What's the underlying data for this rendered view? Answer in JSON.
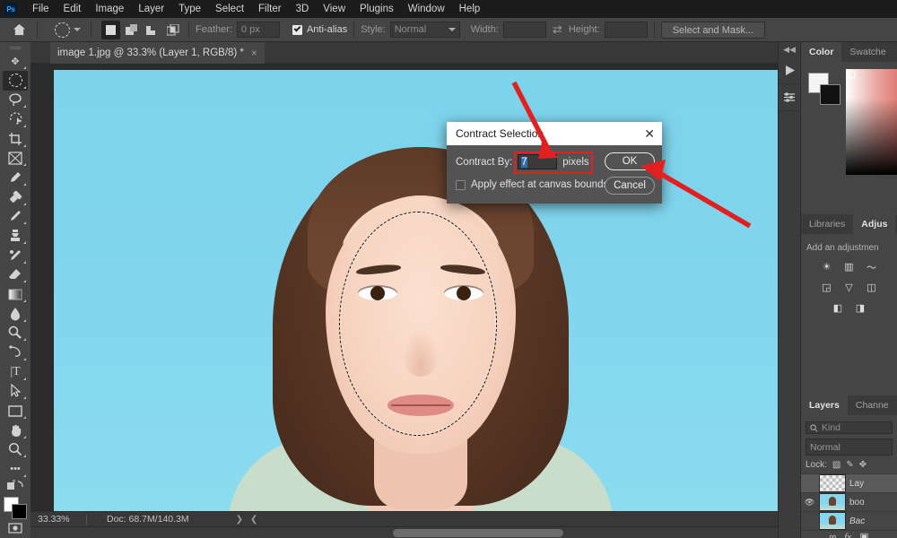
{
  "app": {
    "name": "Ps",
    "logo_bg": "#001e36",
    "logo_fg": "#31a8ff"
  },
  "menubar": {
    "items": [
      {
        "label": "File"
      },
      {
        "label": "Edit"
      },
      {
        "label": "Image"
      },
      {
        "label": "Layer"
      },
      {
        "label": "Type"
      },
      {
        "label": "Select"
      },
      {
        "label": "Filter"
      },
      {
        "label": "3D"
      },
      {
        "label": "View"
      },
      {
        "label": "Plugins"
      },
      {
        "label": "Window"
      },
      {
        "label": "Help"
      }
    ]
  },
  "options_bar": {
    "home_icon": "home-icon",
    "tool_preset_icon": "elliptical-marquee-icon",
    "selection_modes": [
      {
        "name": "new-selection",
        "icon": "square-filled-icon",
        "active": true
      },
      {
        "name": "add-to-selection",
        "icon": "two-squares-icon",
        "active": false
      },
      {
        "name": "subtract-from-selection",
        "icon": "subtract-squares-icon",
        "active": false
      },
      {
        "name": "intersect-selection",
        "icon": "intersect-squares-icon",
        "active": false
      }
    ],
    "feather_label": "Feather:",
    "feather_value": "0 px",
    "antialias_label": "Anti-alias",
    "antialias_checked": true,
    "style_label": "Style:",
    "style_value": "Normal",
    "width_label": "Width:",
    "width_value": "",
    "swap_icon": "swap-arrows-icon",
    "height_label": "Height:",
    "height_value": "",
    "select_and_mask_label": "Select and Mask..."
  },
  "toolbar": {
    "tools": [
      {
        "name": "move-tool",
        "glyph": "✥",
        "active": false
      },
      {
        "name": "elliptical-marquee-tool",
        "glyph": "◯",
        "active": true
      },
      {
        "name": "lasso-tool",
        "glyph": "𝒫",
        "active": false
      },
      {
        "name": "object-selection-tool",
        "glyph": "✧",
        "active": false
      },
      {
        "name": "crop-tool",
        "glyph": "⌗",
        "active": false
      },
      {
        "name": "frame-tool",
        "glyph": "⊠",
        "active": false
      },
      {
        "name": "eyedropper-tool",
        "glyph": "⚲",
        "active": false
      },
      {
        "name": "spot-healing-brush-tool",
        "glyph": "✎",
        "active": false
      },
      {
        "name": "brush-tool",
        "glyph": "🖌",
        "active": false
      },
      {
        "name": "clone-stamp-tool",
        "glyph": "⎈",
        "active": false
      },
      {
        "name": "history-brush-tool",
        "glyph": "❧",
        "active": false
      },
      {
        "name": "eraser-tool",
        "glyph": "◣",
        "active": false
      },
      {
        "name": "gradient-tool",
        "glyph": "▤",
        "active": false
      },
      {
        "name": "blur-tool",
        "glyph": "◗",
        "active": false
      },
      {
        "name": "dodge-tool",
        "glyph": "◐",
        "active": false
      },
      {
        "name": "pen-tool",
        "glyph": "✒",
        "active": false
      },
      {
        "name": "type-tool",
        "glyph": "T",
        "active": false
      },
      {
        "name": "path-selection-tool",
        "glyph": "➤",
        "active": false
      },
      {
        "name": "rectangle-tool",
        "glyph": "▭",
        "active": false
      },
      {
        "name": "hand-tool",
        "glyph": "✋",
        "active": false
      },
      {
        "name": "zoom-tool",
        "glyph": "⌕",
        "active": false
      },
      {
        "name": "edit-toolbar-button",
        "glyph": "•••",
        "active": false
      }
    ],
    "foreground_color": "#ffffff",
    "background_color": "#000000"
  },
  "document": {
    "tab_title": "image 1.jpg @ 33.3% (Layer 1, RGB/8) *",
    "close_icon": "close-icon",
    "canvas_background": "#7cd3ec"
  },
  "statusbar": {
    "zoom": "33.33%",
    "doc_info": "Doc: 68.7M/140.3M"
  },
  "rail": {
    "collapse_icon": "collapse-panels-icon",
    "buttons": [
      {
        "name": "timeline-icon",
        "glyph": "▶"
      },
      {
        "name": "adjustments-sliders-icon",
        "glyph": "⚙"
      }
    ]
  },
  "panels": {
    "color_group": {
      "tabs": [
        {
          "label": "Color",
          "active": true
        },
        {
          "label": "Swatche",
          "active": false
        }
      ],
      "foreground": "#f4f4f4",
      "background": "#111111"
    },
    "adjustments_group": {
      "tabs": [
        {
          "label": "Libraries",
          "active": false
        },
        {
          "label": "Adjus",
          "active": true
        }
      ],
      "hint": "Add an adjustmen",
      "icons": [
        {
          "name": "brightness-contrast-icon",
          "glyph": "☀"
        },
        {
          "name": "levels-icon",
          "glyph": "▥"
        },
        {
          "name": "curves-icon",
          "glyph": "〜"
        },
        {
          "name": "exposure-icon",
          "glyph": "◲"
        },
        {
          "name": "vibrance-icon",
          "glyph": "▽"
        },
        {
          "name": "hue-saturation-icon",
          "glyph": "◫"
        },
        {
          "name": "color-balance-icon",
          "glyph": "◧"
        },
        {
          "name": "black-white-icon",
          "glyph": "◨"
        }
      ]
    },
    "layers_group": {
      "tabs": [
        {
          "label": "Layers",
          "active": true
        },
        {
          "label": "Channe",
          "active": false
        }
      ],
      "filter_placeholder": "Kind",
      "filter_icon": "search-icon",
      "blend_mode": "Normal",
      "lock_label": "Lock:",
      "lock_icons": [
        {
          "name": "lock-transparent-pixels-icon",
          "glyph": "▨"
        },
        {
          "name": "lock-image-pixels-icon",
          "glyph": "🖌"
        },
        {
          "name": "lock-position-icon",
          "glyph": "✥"
        }
      ],
      "layers": [
        {
          "name": "Lay",
          "visible": false,
          "selected": true,
          "transparent": true,
          "italic": false
        },
        {
          "name": "boo",
          "visible": true,
          "selected": false,
          "transparent": false,
          "italic": false
        },
        {
          "name": "Bac",
          "visible": false,
          "selected": false,
          "transparent": false,
          "italic": true
        }
      ],
      "footer_icons": [
        {
          "name": "link-layers-icon",
          "glyph": "∞"
        },
        {
          "name": "layer-style-icon",
          "glyph": "fx"
        },
        {
          "name": "add-mask-icon",
          "glyph": "▣"
        }
      ]
    }
  },
  "dialog": {
    "title": "Contract Selection",
    "close_icon": "close-icon",
    "contract_by_label": "Contract By:",
    "contract_by_value": "7",
    "units_label": "pixels",
    "apply_at_bounds_label": "Apply effect at canvas bounds",
    "apply_at_bounds_checked": false,
    "ok_label": "OK",
    "cancel_label": "Cancel"
  },
  "annotations": {
    "arrow_color": "#e22020",
    "highlight_color": "#e22020",
    "arrows": [
      {
        "name": "arrow-to-contract-by-field",
        "target": "contract-by-input"
      },
      {
        "name": "arrow-to-ok-button",
        "target": "ok-button"
      }
    ]
  }
}
